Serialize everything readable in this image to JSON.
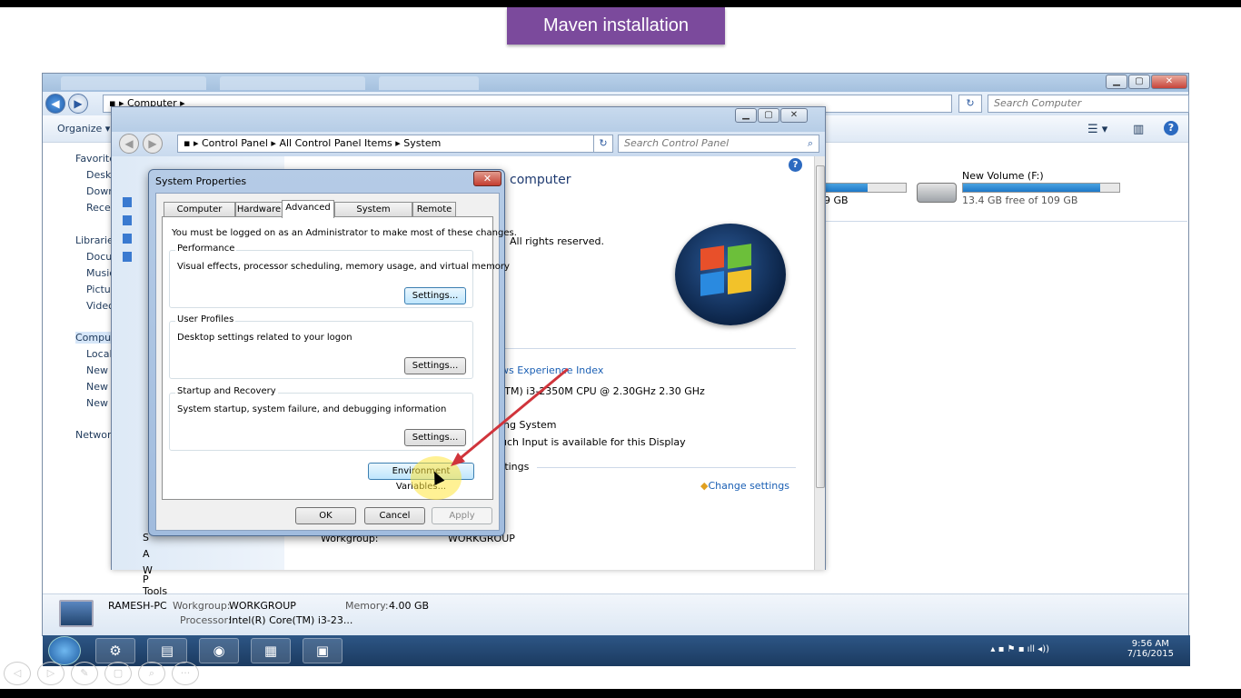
{
  "banner": {
    "title": "Maven installation"
  },
  "explorer": {
    "address": [
      "Computer"
    ],
    "search_placeholder": "Search Computer",
    "toolbar": {
      "organize": "Organize"
    },
    "sidebar": {
      "favorites": "Favorites",
      "items": [
        "Desktop",
        "Downloads",
        "Recent Places",
        "Libraries",
        "Documents",
        "Music",
        "Pictures",
        "Videos",
        "Computer",
        "Local Disk",
        "New Volume",
        "New Volume",
        "New Volume",
        "Network"
      ]
    },
    "drive": {
      "name": "New Volume (F:)",
      "free": "13.4 GB free of 109 GB",
      "fill": 0.88
    },
    "drive_prev": {
      "free_tail": "9 GB",
      "fill": 0.55
    },
    "details": {
      "pc_name": "RAMESH-PC",
      "workgroup_label": "Workgroup:",
      "workgroup": "WORKGROUP",
      "memory_label": "Memory:",
      "memory": "4.00 GB",
      "processor_label": "Processor:",
      "processor": "Intel(R) Core(TM) i3-23..."
    }
  },
  "control_panel": {
    "address": [
      "Control Panel",
      "All Control Panel Items",
      "System"
    ],
    "search_placeholder": "Search Control Panel",
    "heading": "computer",
    "rights": "All rights reserved.",
    "wei_link": "ws Experience Index",
    "cpu": "(TM) i3-2350M CPU @ 2.30GHz   2.30 GHz",
    "os": "ing System",
    "touch": "uch Input is available for this Display",
    "settings_header": "ttings",
    "change_settings": "Change settings",
    "workgroup_label": "Workgroup:",
    "workgroup": "WORKGROUP",
    "see_also": "S",
    "left_items": [
      "A",
      "W",
      "P"
    ],
    "tools": "Tools"
  },
  "dialog": {
    "title": "System Properties",
    "tabs": [
      "Computer Name",
      "Hardware",
      "Advanced",
      "System Protection",
      "Remote"
    ],
    "active_tab": "Advanced",
    "admin_note": "You must be logged on as an Administrator to make most of these changes.",
    "performance": {
      "label": "Performance",
      "desc": "Visual effects, processor scheduling, memory usage, and virtual memory",
      "button": "Settings..."
    },
    "profiles": {
      "label": "User Profiles",
      "desc": "Desktop settings related to your logon",
      "button": "Settings..."
    },
    "startup": {
      "label": "Startup and Recovery",
      "desc": "System startup, system failure, and debugging information",
      "button": "Settings..."
    },
    "env_button": "Environment Variables...",
    "ok": "OK",
    "cancel": "Cancel",
    "apply": "Apply"
  },
  "taskbar": {
    "time": "9:56 AM",
    "date": "7/16/2015"
  },
  "colors": {
    "banner": "#7b4a9c",
    "annotation_arrow": "#d0343b",
    "highlight": "#ffe63c"
  }
}
